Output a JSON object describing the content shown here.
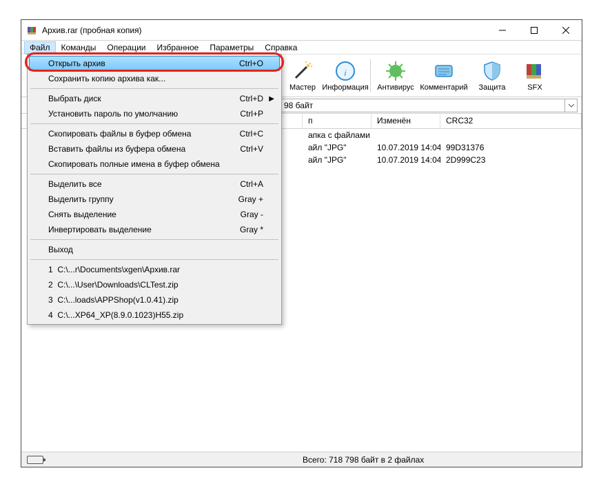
{
  "title": "Архив.rar (пробная копия)",
  "menubar": [
    "Файл",
    "Команды",
    "Операции",
    "Избранное",
    "Параметры",
    "Справка"
  ],
  "toolbar": [
    {
      "label": "Мастер",
      "icon": "wand"
    },
    {
      "label": "Информация",
      "icon": "info"
    },
    {
      "label": "Антивирус",
      "icon": "virus"
    },
    {
      "label": "Комментарий",
      "icon": "comment"
    },
    {
      "label": "Защита",
      "icon": "shield"
    },
    {
      "label": "SFX",
      "icon": "sfx"
    }
  ],
  "path_suffix": "98 байт",
  "columns": {
    "type": "п",
    "modified": "Изменён",
    "crc": "CRC32"
  },
  "rows": [
    {
      "type": "апка с файлами",
      "modified": "",
      "crc": ""
    },
    {
      "type": "айл \"JPG\"",
      "modified": "10.07.2019 14:04",
      "crc": "99D31376"
    },
    {
      "type": "айл \"JPG\"",
      "modified": "10.07.2019 14:04",
      "crc": "2D999C23"
    }
  ],
  "status": "Всего: 718 798 байт в 2 файлах",
  "menu": {
    "open_archive": {
      "label": "Открыть архив",
      "shortcut": "Ctrl+O"
    },
    "save_copy": {
      "label": "Сохранить копию архива как..."
    },
    "choose_drive": {
      "label": "Выбрать диск",
      "shortcut": "Ctrl+D",
      "sub": true
    },
    "set_password": {
      "label": "Установить пароль по умолчанию",
      "shortcut": "Ctrl+P"
    },
    "copy_files": {
      "label": "Скопировать файлы в буфер обмена",
      "shortcut": "Ctrl+C"
    },
    "paste_files": {
      "label": "Вставить файлы из буфера обмена",
      "shortcut": "Ctrl+V"
    },
    "copy_names": {
      "label": "Скопировать полные имена в буфер обмена"
    },
    "select_all": {
      "label": "Выделить все",
      "shortcut": "Ctrl+A"
    },
    "select_group": {
      "label": "Выделить группу",
      "shortcut": "Gray +"
    },
    "deselect": {
      "label": "Снять выделение",
      "shortcut": "Gray -"
    },
    "invert": {
      "label": "Инвертировать выделение",
      "shortcut": "Gray *"
    },
    "exit": {
      "label": "Выход"
    },
    "recent": [
      {
        "n": "1",
        "path": "C:\\...r\\Documents\\xgen\\Архив.rar"
      },
      {
        "n": "2",
        "path": "C:\\...\\User\\Downloads\\CLTest.zip"
      },
      {
        "n": "3",
        "path": "C:\\...loads\\APPShop(v1.0.41).zip"
      },
      {
        "n": "4",
        "path": "C:\\...XP64_XP(8.9.0.1023)H55.zip"
      }
    ]
  }
}
